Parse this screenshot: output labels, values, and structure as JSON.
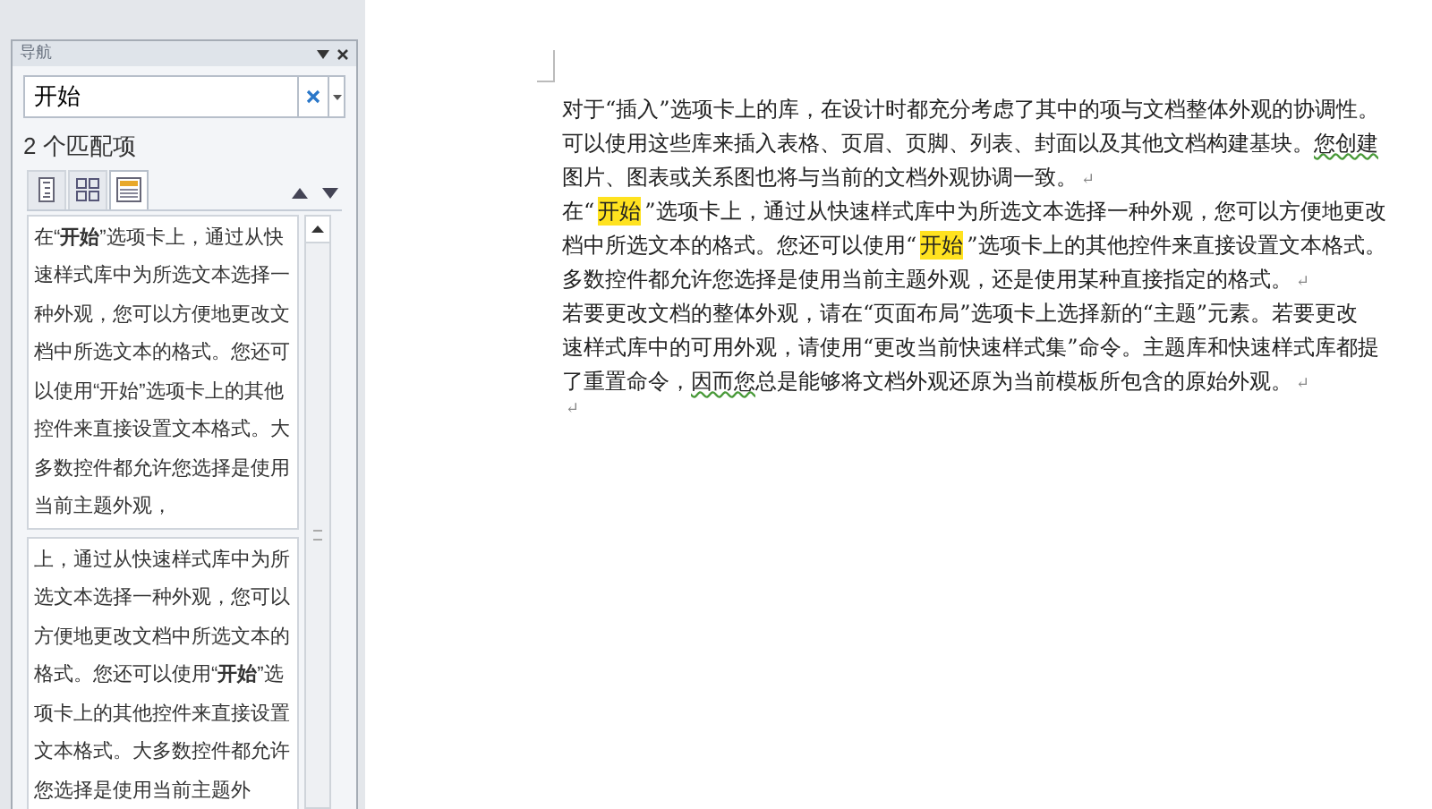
{
  "nav_pane": {
    "title": "导航",
    "search": {
      "value": "开始"
    },
    "match_count": "2 个匹配项",
    "tabs": [
      {
        "kind": "headings",
        "selected": false
      },
      {
        "kind": "pages",
        "selected": false
      },
      {
        "kind": "results",
        "selected": true
      }
    ],
    "results": [
      {
        "text": "在“**开始**”选项卡上，通过从快速样式库中为所选文本选择一种外观，您可以方便地更改文档中所选文本的格式。您还可以使用“开始”选项卡上的其他控件来直接设置文本格式。大多数控件都允许您选择是使用当前主题外观，"
      },
      {
        "text": "上，通过从快速样式库中为所选文本选择一种外观，您可以方便地更改文档中所选文本的格式。您还可以使用“**开始**”选项卡上的其他控件来直接设置文本格式。大多数控件都允许您选择是使用当前主题外"
      }
    ]
  },
  "document": {
    "lines": [
      [
        {
          "kind": "text",
          "text": "对于“插入”选项卡上的库，在设计时都充分考虑了其中的项与文档整体外观的协调性。"
        }
      ],
      [
        {
          "kind": "text",
          "text": "可以使用这些库来插入表格、页眉、页脚、列表、封面以及其他文档构建基块。 "
        },
        {
          "kind": "underline",
          "text": "您创建"
        }
      ],
      [
        {
          "kind": "text",
          "text": "图片、图表或关系图也将与当前的文档外观协调一致。"
        },
        {
          "kind": "mark",
          "text": "↵"
        }
      ],
      [
        {
          "kind": "text",
          "text": "在“"
        },
        {
          "kind": "highlight",
          "text": "开始"
        },
        {
          "kind": "text",
          "text": "”选项卡上，通过从快速样式库中为所选文本选择一种外观，您可以方便地更改"
        }
      ],
      [
        {
          "kind": "text",
          "text": "档中所选文本的格式。您还可以使用“"
        },
        {
          "kind": "highlight",
          "text": "开始"
        },
        {
          "kind": "text",
          "text": "”选项卡上的其他控件来直接设置文本格式。"
        }
      ],
      [
        {
          "kind": "text",
          "text": "多数控件都允许您选择是使用当前主题外观，还是使用某种直接指定的格式。"
        },
        {
          "kind": "mark",
          "text": "↵"
        }
      ],
      [
        {
          "kind": "text",
          "text": "若要更改文档的整体外观，请在“页面布局”选项卡上选择新的“主题”元素。若要更改"
        }
      ],
      [
        {
          "kind": "text",
          "text": "速样式库中的可用外观，请使用“更改当前快速样式集”命令。主题库和快速样式库都提"
        }
      ],
      [
        {
          "kind": "text",
          "text": "了重置命令，"
        },
        {
          "kind": "underline",
          "text": "因而您"
        },
        {
          "kind": "text",
          "text": "总是能够将文档外观还原为当前模板所包含的原始外观。"
        },
        {
          "kind": "mark",
          "text": "↵"
        }
      ],
      [
        {
          "kind": "mark",
          "text": "↵"
        }
      ]
    ]
  }
}
